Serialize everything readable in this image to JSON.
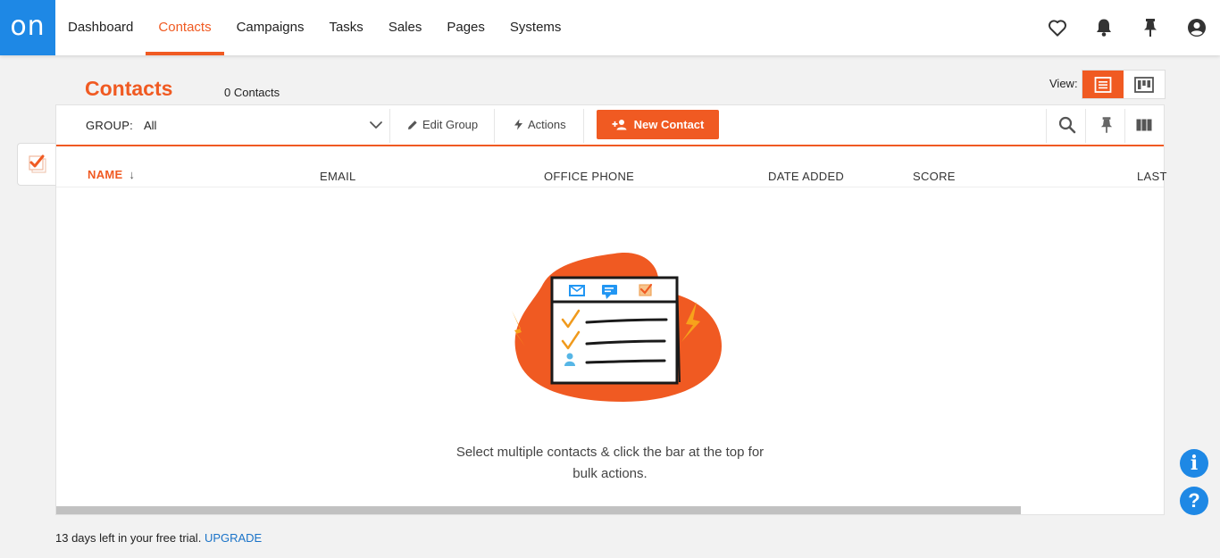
{
  "app": {
    "logo_text": "on",
    "accent_color": "#f05a22",
    "brand_color": "#1e88e5"
  },
  "nav": {
    "items": [
      {
        "label": "Dashboard"
      },
      {
        "label": "Contacts",
        "active": true
      },
      {
        "label": "Campaigns"
      },
      {
        "label": "Tasks"
      },
      {
        "label": "Sales"
      },
      {
        "label": "Pages"
      },
      {
        "label": "Systems"
      }
    ],
    "icons": [
      "heart-icon",
      "bell-icon",
      "pin-icon",
      "account-icon"
    ]
  },
  "header": {
    "title": "Contacts",
    "count": "0 Contacts",
    "view_label": "View:",
    "view_options": [
      "list-view-icon",
      "kanban-view-icon"
    ],
    "active_view": "list"
  },
  "toolbar": {
    "group_label": "GROUP:",
    "group_value": "All",
    "edit_group": "Edit Group",
    "actions": "Actions",
    "new_contact": "New Contact",
    "icons": [
      "search-icon",
      "pin-icon",
      "columns-icon"
    ]
  },
  "table": {
    "columns": [
      "NAME",
      "EMAIL",
      "OFFICE PHONE",
      "DATE ADDED",
      "SCORE",
      "LAST"
    ],
    "sort_column": "NAME",
    "sort_direction": "desc",
    "rows": []
  },
  "empty_state": {
    "message_line1": "Select multiple contacts & click the bar at the top for",
    "message_line2": "bulk actions."
  },
  "footer": {
    "trial_text": "13 days left in your free trial.",
    "upgrade_link": "UPGRADE"
  },
  "help": {
    "info_icon": "info-icon",
    "help_icon": "help-icon"
  }
}
